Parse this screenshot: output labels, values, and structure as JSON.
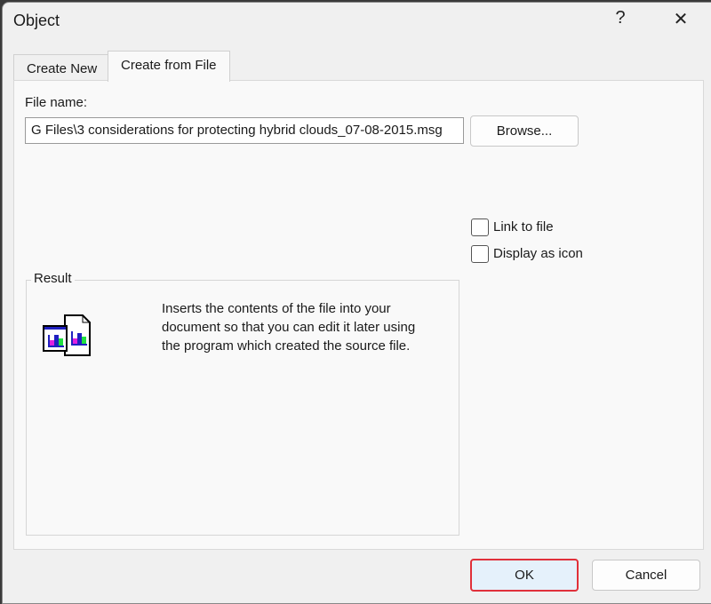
{
  "dialog": {
    "title": "Object",
    "help_label": "?",
    "close_label": "✕"
  },
  "tabs": [
    {
      "label": "Create New"
    },
    {
      "label": "Create from File"
    }
  ],
  "file_name_label": "File name:",
  "file_name_value": "G Files\\3 considerations for protecting hybrid clouds_07-08-2015.msg",
  "browse_label": "Browse...",
  "link_to_file_label": "Link to file",
  "display_as_icon_label": "Display as icon",
  "result": {
    "heading": "Result",
    "text": "Inserts the contents of the file into your document so that you can edit it later using the program which created the source file."
  },
  "ok_label": "OK",
  "cancel_label": "Cancel"
}
